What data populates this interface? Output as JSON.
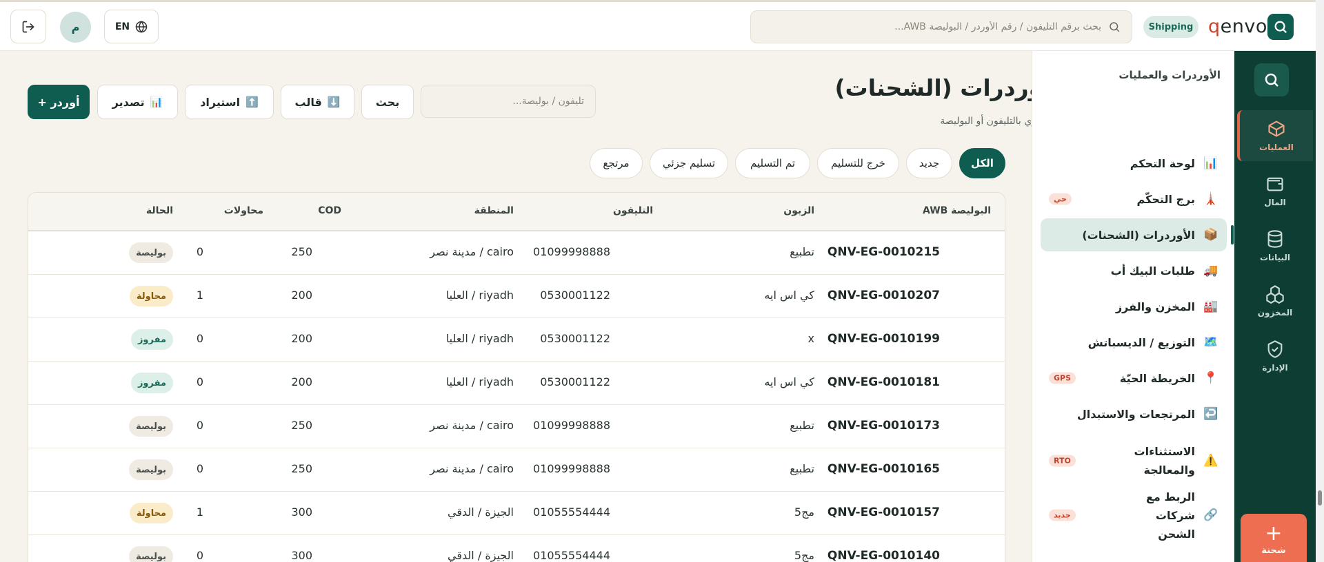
{
  "topbar": {
    "lang_label": "EN",
    "avatar_initial": "م",
    "search_placeholder": "بحث برقم التليفون / رقم الأوردر / البوليصة AWB...",
    "shipping_badge": "Shipping",
    "brand_q": "q",
    "brand_rest": "envo"
  },
  "rail": {
    "items": [
      {
        "label": "العمليات",
        "icon": "box-icon",
        "active": true
      },
      {
        "label": "المال",
        "icon": "wallet-icon",
        "active": false
      },
      {
        "label": "البيانات",
        "icon": "database-icon",
        "active": false
      },
      {
        "label": "المخزون",
        "icon": "boxes-icon",
        "active": false
      },
      {
        "label": "الإدارة",
        "icon": "shield-icon",
        "active": false
      }
    ],
    "add_label": "شحنة"
  },
  "sidebar": {
    "title": "الأوردرات والعمليات",
    "items": [
      {
        "label": "لوحة التحكم",
        "icon": "📊",
        "badge": ""
      },
      {
        "label": "برج التحكّم",
        "icon": "🗼",
        "badge": "حي"
      },
      {
        "label": "الأوردرات (الشحنات)",
        "icon": "📦",
        "badge": ""
      },
      {
        "label": "طلبات البيك أب",
        "icon": "🚚",
        "badge": ""
      },
      {
        "label": "المخزن والفرز",
        "icon": "🏭",
        "badge": ""
      },
      {
        "label": "التوزيع / الديسباتش",
        "icon": "🗺️",
        "badge": ""
      },
      {
        "label": "الخريطة الحيّة",
        "icon": "📍",
        "badge": "GPS"
      },
      {
        "label": "المرتجعات والاستبدال",
        "icon": "↩️",
        "badge": ""
      },
      {
        "label": "الاستثناءات والمعالجة",
        "icon": "⚠️",
        "badge": "RTO"
      },
      {
        "label": "الربط مع شركات الشحن",
        "icon": "🔗",
        "badge": "جديد"
      }
    ]
  },
  "main": {
    "title": "الأوردرات (الشحنات)",
    "subtitle": "بحث فوري بالتليفون أو البوليصة",
    "search_placeholder": "تليفون / بوليصة...",
    "search_btn": "بحث",
    "template_btn": "قالب",
    "template_icon": "⬇️",
    "import_btn": "استيراد",
    "import_icon": "⬆️",
    "export_btn": "تصدير",
    "export_icon": "📊",
    "new_order_btn": "+ أوردر",
    "filters": [
      "الكل",
      "جديد",
      "خرج للتسليم",
      "تم التسليم",
      "تسليم جزئي",
      "مرتجع"
    ]
  },
  "table": {
    "headers": {
      "awb": "البوليصة AWB",
      "customer": "الزبون",
      "phone": "التليفون",
      "region": "المنطقة",
      "cod": "COD",
      "attempts": "محاولات",
      "status": "الحالة"
    },
    "rows": [
      {
        "awb": "QNV-EG-0010215",
        "customer": "تطبيع",
        "phone": "01099998888",
        "region": "cairo / مدينة نصر",
        "cod": "250",
        "attempts": "0",
        "status": "بوليصة",
        "status_type": "neutral"
      },
      {
        "awb": "QNV-EG-0010207",
        "customer": "كي اس ايه",
        "phone": "0530001122",
        "region": "riyadh / العليا",
        "cod": "200",
        "attempts": "1",
        "status": "محاولة",
        "status_type": "warn"
      },
      {
        "awb": "QNV-EG-0010199",
        "customer": "x",
        "phone": "0530001122",
        "region": "riyadh / العليا",
        "cod": "200",
        "attempts": "0",
        "status": "مفروز",
        "status_type": "ok"
      },
      {
        "awb": "QNV-EG-0010181",
        "customer": "كي اس ايه",
        "phone": "0530001122",
        "region": "riyadh / العليا",
        "cod": "200",
        "attempts": "0",
        "status": "مفروز",
        "status_type": "ok"
      },
      {
        "awb": "QNV-EG-0010173",
        "customer": "تطبيع",
        "phone": "01099998888",
        "region": "cairo / مدينة نصر",
        "cod": "250",
        "attempts": "0",
        "status": "بوليصة",
        "status_type": "neutral"
      },
      {
        "awb": "QNV-EG-0010165",
        "customer": "تطبيع",
        "phone": "01099998888",
        "region": "cairo / مدينة نصر",
        "cod": "250",
        "attempts": "0",
        "status": "بوليصة",
        "status_type": "neutral"
      },
      {
        "awb": "QNV-EG-0010157",
        "customer": "مج5",
        "phone": "01055554444",
        "region": "الجيزة / الدقي",
        "cod": "300",
        "attempts": "1",
        "status": "محاولة",
        "status_type": "warn"
      },
      {
        "awb": "QNV-EG-0010140",
        "customer": "مج5",
        "phone": "01055554444",
        "region": "الجيزة / الدقي",
        "cod": "300",
        "attempts": "0",
        "status": "بوليصة",
        "status_type": "neutral"
      }
    ]
  },
  "colors": {
    "primary": "#0f5c50",
    "accent": "#ee6e51",
    "rail_bg": "#0e3d34"
  }
}
